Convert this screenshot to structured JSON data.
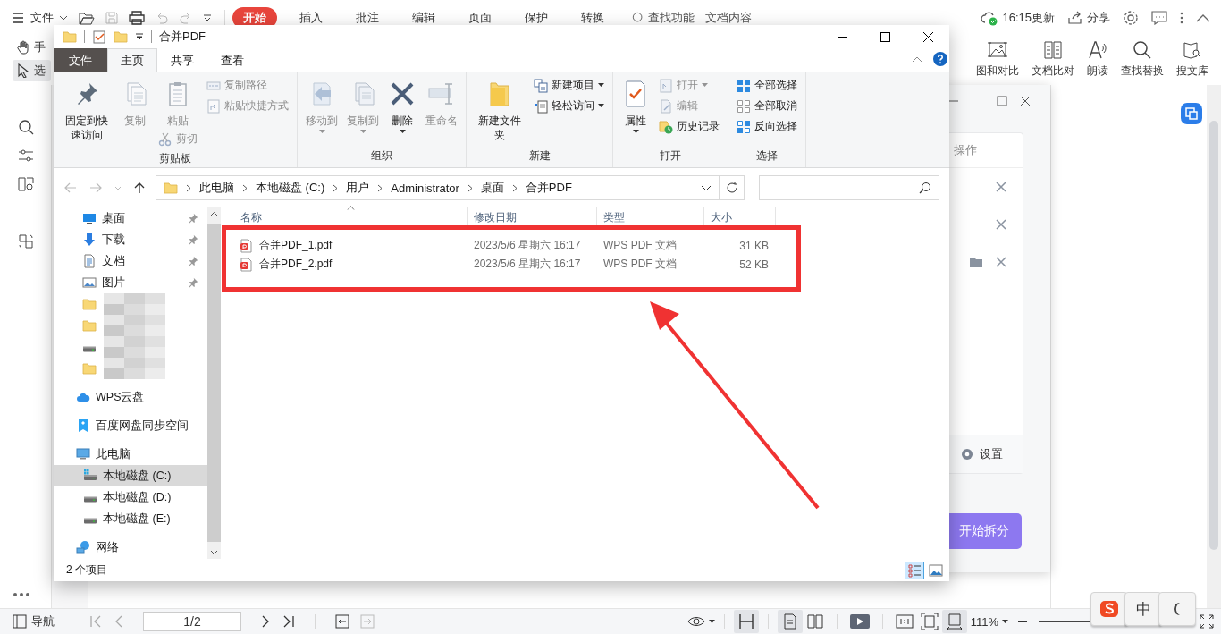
{
  "wps": {
    "file_menu": "文件",
    "tabs": [
      {
        "label": "开始",
        "selected": true
      },
      {
        "label": "插入",
        "selected": false
      },
      {
        "label": "批注",
        "selected": false
      },
      {
        "label": "编辑",
        "selected": false
      },
      {
        "label": "页面",
        "selected": false
      },
      {
        "label": "保护",
        "selected": false
      },
      {
        "label": "转换",
        "selected": false
      }
    ],
    "find_feature": "查找功能",
    "doc_content": "文档内容",
    "sync_status": "16:15更新",
    "share": "分享",
    "tools": [
      {
        "label": "手",
        "kind": "hand",
        "selected": false
      },
      {
        "label": "选",
        "kind": "select",
        "selected": true
      }
    ],
    "ribbon_tools": [
      {
        "label": "图和对比",
        "kind": "image-compare"
      },
      {
        "label": "文档比对",
        "kind": "doc-compare"
      },
      {
        "label": "朗读",
        "kind": "read-aloud"
      },
      {
        "label": "查找替换",
        "kind": "find"
      },
      {
        "label": "搜文库",
        "kind": "library"
      }
    ],
    "status_bar": {
      "nav": "导航",
      "page": "1/2",
      "zoom": "111%",
      "view_buttons": [
        {
          "kind": "eye",
          "selected": false
        },
        {
          "kind": "fit-width",
          "selected": true
        },
        {
          "kind": "single-page",
          "selected": true
        },
        {
          "kind": "two-page",
          "selected": false
        },
        {
          "kind": "play",
          "selected": false
        },
        {
          "kind": "actual-size",
          "selected": false
        },
        {
          "kind": "fit-page",
          "selected": false
        },
        {
          "kind": "fit-window",
          "selected": true
        }
      ]
    }
  },
  "split_dialog": {
    "header": "操作",
    "rows": [
      {
        "kind": "file"
      },
      {
        "kind": "file"
      },
      {
        "kind": "folder"
      }
    ],
    "settings": "设置",
    "start_button": "开始拆分"
  },
  "explorer": {
    "title": "合并PDF",
    "tabs": [
      {
        "label": "文件",
        "kind": "menu",
        "selected": false
      },
      {
        "label": "主页",
        "kind": "tab",
        "selected": true
      },
      {
        "label": "共享",
        "kind": "tab",
        "selected": false
      },
      {
        "label": "查看",
        "kind": "tab",
        "selected": false
      }
    ],
    "ribbon": [
      {
        "label": "剪贴板",
        "columns": [
          [
            {
              "label": "固定到快速访问",
              "kind": "large",
              "disabled": false
            }
          ],
          [
            {
              "label": "复制",
              "kind": "large",
              "disabled": true
            }
          ],
          [
            {
              "label": "粘贴",
              "kind": "large",
              "disabled": true
            },
            {
              "label": "剪切",
              "kind": "small",
              "disabled": true
            }
          ],
          [
            {
              "label": "复制路径",
              "kind": "small",
              "disabled": true
            },
            {
              "label": "粘贴快捷方式",
              "kind": "small",
              "disabled": true
            }
          ]
        ]
      },
      {
        "label": "组织",
        "columns": [
          [
            {
              "label": "移动到",
              "kind": "large",
              "disabled": true,
              "has_menu": true
            }
          ],
          [
            {
              "label": "复制到",
              "kind": "large",
              "disabled": true,
              "has_menu": true
            }
          ],
          [
            {
              "label": "删除",
              "kind": "large",
              "disabled": false,
              "has_menu": true
            }
          ],
          [
            {
              "label": "重命名",
              "kind": "large",
              "disabled": true
            }
          ]
        ]
      },
      {
        "label": "新建",
        "columns": [
          [
            {
              "label": "新建文件夹",
              "kind": "large",
              "disabled": false
            }
          ],
          [
            {
              "label": "新建项目",
              "kind": "small",
              "disabled": false,
              "has_menu": true
            },
            {
              "label": "轻松访问",
              "kind": "small",
              "disabled": false,
              "has_menu": true
            }
          ]
        ]
      },
      {
        "label": "打开",
        "columns": [
          [
            {
              "label": "属性",
              "kind": "large",
              "disabled": false,
              "has_menu": true
            }
          ],
          [
            {
              "label": "打开",
              "kind": "small",
              "disabled": true,
              "has_menu": true
            },
            {
              "label": "编辑",
              "kind": "small",
              "disabled": true
            },
            {
              "label": "历史记录",
              "kind": "small",
              "disabled": false
            }
          ]
        ]
      },
      {
        "label": "选择",
        "columns": [
          [
            {
              "label": "全部选择",
              "kind": "small",
              "disabled": false
            },
            {
              "label": "全部取消",
              "kind": "small",
              "disabled": false
            },
            {
              "label": "反向选择",
              "kind": "small",
              "disabled": false
            }
          ]
        ]
      }
    ],
    "breadcrumbs": [
      "此电脑",
      "本地磁盘 (C:)",
      "用户",
      "Administrator",
      "桌面",
      "合并PDF"
    ],
    "nav": [
      {
        "items": [
          {
            "label": "桌面",
            "kind": "desktop",
            "pinned": true,
            "selected": false
          },
          {
            "label": "下载",
            "kind": "download",
            "pinned": true,
            "selected": false
          },
          {
            "label": "文档",
            "kind": "document",
            "pinned": true,
            "selected": false
          },
          {
            "label": "图片",
            "kind": "pictures",
            "pinned": true,
            "selected": false
          },
          {
            "kind": "folder",
            "redacted": true,
            "selected": false
          },
          {
            "kind": "folder",
            "redacted": true,
            "selected": false
          },
          {
            "kind": "drive",
            "redacted": true,
            "selected": false
          },
          {
            "kind": "folder",
            "redacted": true,
            "selected": false
          }
        ]
      },
      {
        "items": [
          {
            "label": "WPS云盘",
            "kind": "cloud",
            "selected": false
          }
        ]
      },
      {
        "items": [
          {
            "label": "百度网盘同步空间",
            "kind": "baidu",
            "selected": false
          }
        ]
      },
      {
        "items": [
          {
            "label": "此电脑",
            "kind": "pc",
            "selected": false,
            "children": [
              {
                "label": "本地磁盘 (C:)",
                "kind": "system-drive",
                "selected": true
              },
              {
                "label": "本地磁盘 (D:)",
                "kind": "drive",
                "selected": false
              },
              {
                "label": "本地磁盘 (E:)",
                "kind": "drive",
                "selected": false
              }
            ]
          }
        ]
      },
      {
        "items": [
          {
            "label": "网络",
            "kind": "network",
            "selected": false
          }
        ]
      }
    ],
    "columns": [
      "名称",
      "修改日期",
      "类型",
      "大小"
    ],
    "files": [
      {
        "name": "合并PDF_1.pdf",
        "modified": "2023/5/6 星期六 16:17",
        "type": "WPS PDF 文档",
        "size": "31 KB"
      },
      {
        "name": "合并PDF_2.pdf",
        "modified": "2023/5/6 星期六 16:17",
        "type": "WPS PDF 文档",
        "size": "52 KB"
      }
    ],
    "status": "2 个项目",
    "views": [
      {
        "kind": "details",
        "selected": true
      },
      {
        "kind": "thumbnails",
        "selected": false
      }
    ]
  },
  "ime": {
    "mode": "中"
  }
}
